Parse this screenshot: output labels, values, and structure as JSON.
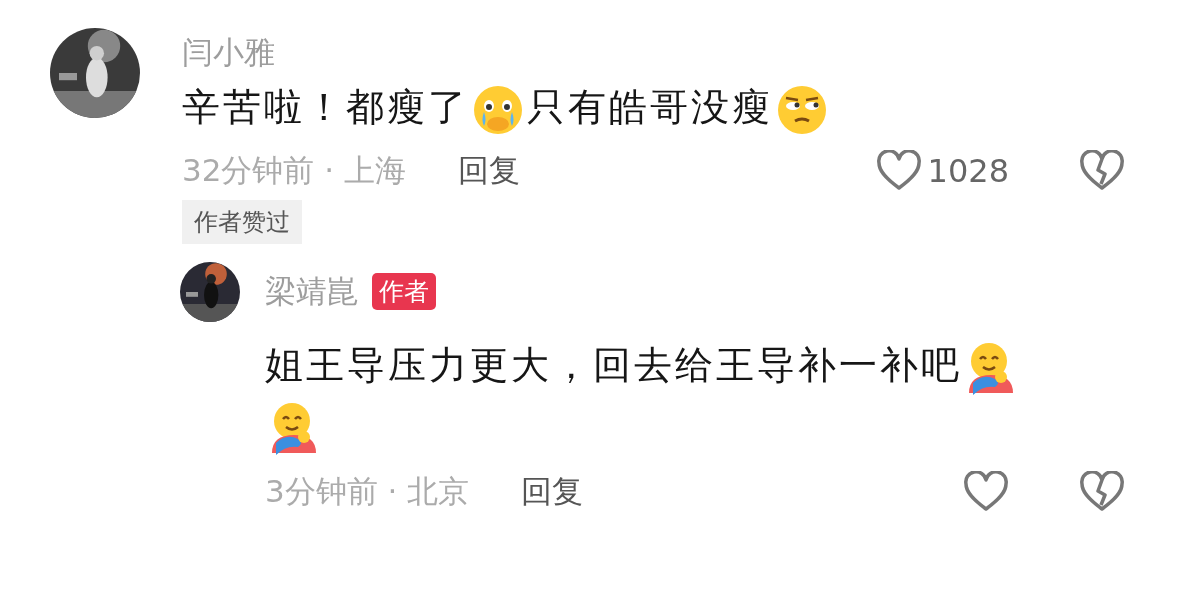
{
  "comments": [
    {
      "author": "闫小雅",
      "segments": [
        {
          "kind": "text",
          "text": "辛苦啦！都瘦了"
        },
        {
          "kind": "tear-face"
        },
        {
          "kind": "text",
          "text": "只有皓哥没瘦"
        },
        {
          "kind": "side-eye-face"
        }
      ],
      "meta": "32分钟前 · 上海",
      "reply_label": "回复",
      "likes": "1028",
      "liked_tag": "作者赞过",
      "reply": false
    },
    {
      "author": "梁靖崑",
      "author_tag": "作者",
      "segments": [
        {
          "kind": "text",
          "text": "姐王导压力更大，回去给王导补一补吧"
        },
        {
          "kind": "hug-face"
        },
        {
          "kind": "hug-face"
        }
      ],
      "meta": "3分钟前 · 北京",
      "reply_label": "回复",
      "reply": true
    }
  ]
}
